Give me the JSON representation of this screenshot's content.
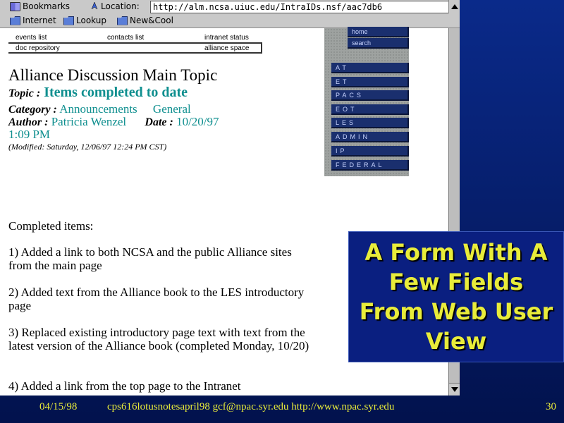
{
  "toolbar": {
    "bookmarks_label": "Bookmarks",
    "location_label": "Location:",
    "url": "http://alm.ncsa.uiuc.edu/IntraIDs.nsf/aac7db6",
    "personal": [
      "Internet",
      "Lookup",
      "New&Cool"
    ]
  },
  "page_nav": {
    "events_list": "events list",
    "contacts_list": "contacts list",
    "intranet_status": "intranet status",
    "doc_repository": "doc repository",
    "alliance_space": "alliance space"
  },
  "side_nav": {
    "home": "home",
    "search": "search",
    "items": [
      "AT",
      "ET",
      "PACS",
      "EOT",
      "LES",
      "ADMIN",
      "IP",
      "FEDERAL"
    ]
  },
  "document": {
    "title": "Alliance Discussion Main Topic",
    "topic_label": "Topic :",
    "topic": "Items completed to date",
    "category_label": "Category :",
    "category": "Announcements",
    "category2": "General",
    "author_label": "Author :",
    "author": "Patricia Wenzel",
    "date_label": "Date :",
    "date": "10/20/97",
    "time": "1:09 PM",
    "modified": "(Modified: Saturday, 12/06/97 12:24 PM CST)",
    "completed_heading": "Completed items:",
    "items": [
      "1) Added a link to both NCSA and the public Alliance sites from the main page",
      "2) Added text from the Alliance book to the LES introductory page",
      "3) Replaced existing introductory page text with text from the latest version of the Alliance book (completed Monday, 10/20)",
      "4) Added a link from the top page to the Intranet"
    ]
  },
  "callout": {
    "text": "A Form With A Few Fields From Web User View"
  },
  "footer": {
    "date": "04/15/98",
    "info": "cps616lotusnotesapril98  gcf@npac.syr.edu http://www.npac.syr.edu",
    "page": "30"
  },
  "colors": {
    "slide_background": "#0a2a8a",
    "callout_text": "#e8ec3a",
    "teal_value": "#0f8f8f",
    "nav_button": "#1a2f6e"
  }
}
